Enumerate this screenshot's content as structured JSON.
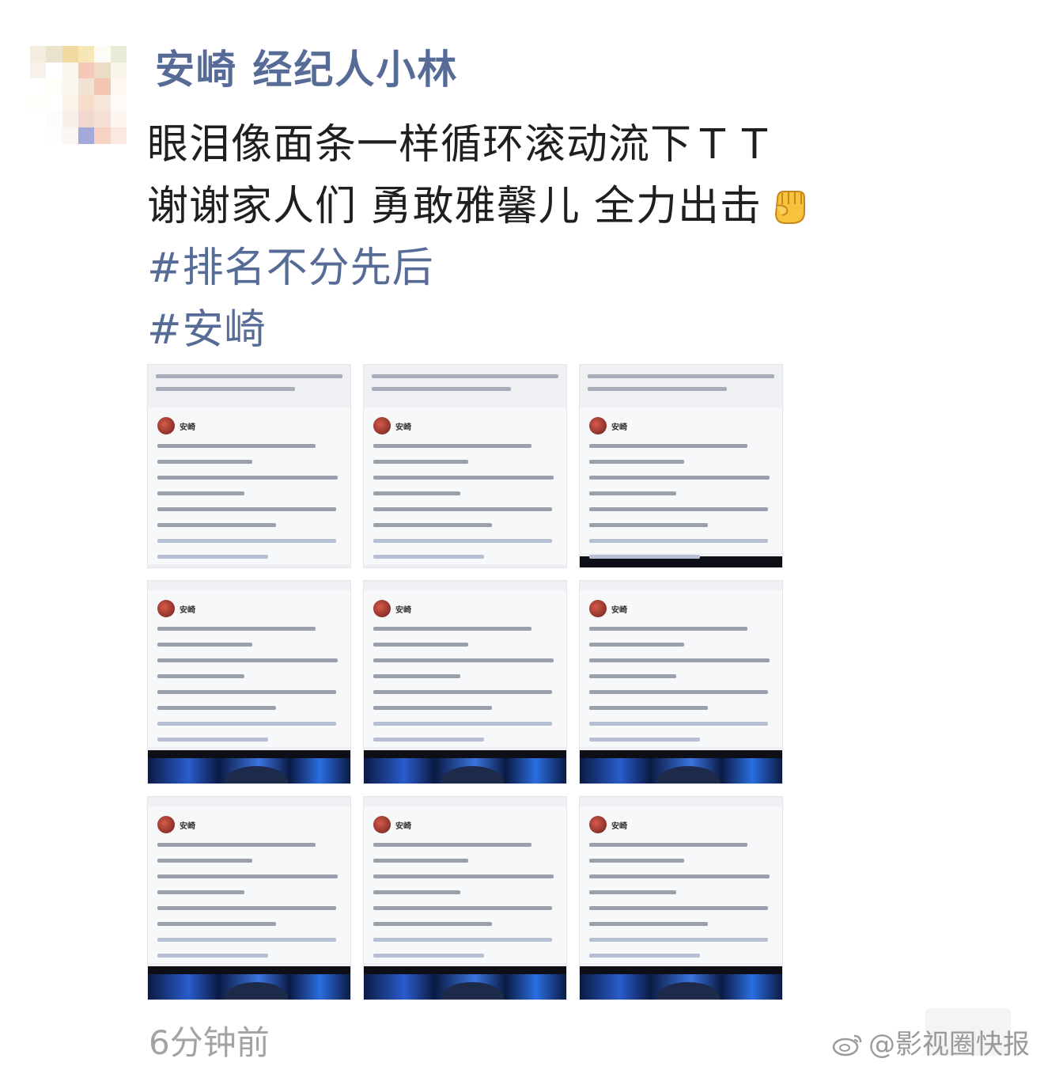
{
  "post": {
    "username": "安崎 经纪人小林",
    "lines": [
      "眼泪像面条一样循环滚动流下ＴＴ",
      "谢谢家人们 勇敢雅馨儿 全力出击"
    ],
    "emoji_icon": "raised-fist-icon",
    "hashtags": [
      "#排名不分先后",
      "#安崎"
    ],
    "timestamp": "6分钟前"
  },
  "images": {
    "count": 9,
    "card_author": "安崎"
  },
  "watermark": {
    "text": "@影视圈快报",
    "icon": "weibo-logo-icon"
  },
  "colors": {
    "username": "#566b96",
    "hashtag": "#566b96",
    "body_text": "#1f1f1f",
    "timestamp": "#a3a3a3"
  }
}
